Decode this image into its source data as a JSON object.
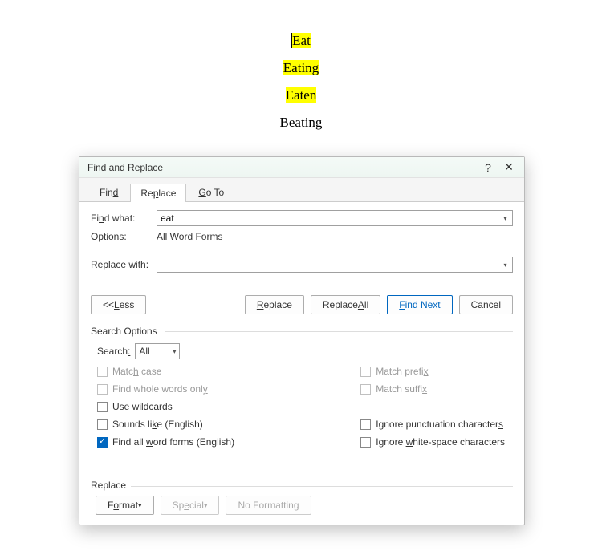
{
  "doc": {
    "w1": "Eat",
    "w2": "Eating",
    "w3": "Eaten",
    "w4": "Beating"
  },
  "dialog": {
    "title": "Find and Replace",
    "help": "?",
    "close": "✕",
    "tabs": {
      "find": "Find",
      "replace": "Replace",
      "goto": "Go To"
    },
    "find_what_label": "Find what:",
    "find_what_value": "eat",
    "options_label": "Options:",
    "options_value": "All Word Forms",
    "replace_with_label": "Replace with:",
    "replace_with_value": "",
    "buttons": {
      "less": "<< Less",
      "replace": "Replace",
      "replace_all": "Replace All",
      "find_next": "Find Next",
      "cancel": "Cancel"
    },
    "search_options_title": "Search Options",
    "search_label": "Search:",
    "search_value": "All",
    "checks": {
      "match_case": "Match case",
      "whole_words": "Find whole words only",
      "wildcards": "Use wildcards",
      "sounds_like": "Sounds like (English)",
      "word_forms": "Find all word forms (English)",
      "match_prefix": "Match prefix",
      "match_suffix": "Match suffix",
      "ignore_punct": "Ignore punctuation characters",
      "ignore_ws": "Ignore white-space characters"
    },
    "bottom": {
      "title": "Replace",
      "format": "Format",
      "special": "Special",
      "no_formatting": "No Formatting"
    }
  }
}
